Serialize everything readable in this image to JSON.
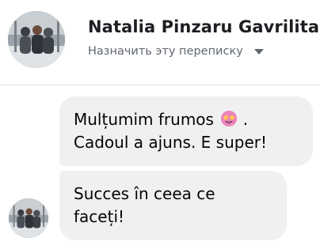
{
  "header": {
    "contact_name": "Natalia Pinzaru Gavrilita",
    "assign_label": "Назначить эту переписку",
    "assign_icon": "chevron-down-icon"
  },
  "messages": [
    {
      "line1_text": "Mulțumim frumos",
      "line1_emoji": "star-struck-emoji-icon",
      "line1_after": ".",
      "line2": "Cadoul a ajuns. E super!"
    },
    {
      "line1": "Succes în ceea ce",
      "line2": "faceți!"
    }
  ],
  "colors": {
    "bubble_bg": "#f0f0f0",
    "name_text": "#1c1e21",
    "secondary_text": "#606770",
    "divider": "#e4e6eb"
  }
}
